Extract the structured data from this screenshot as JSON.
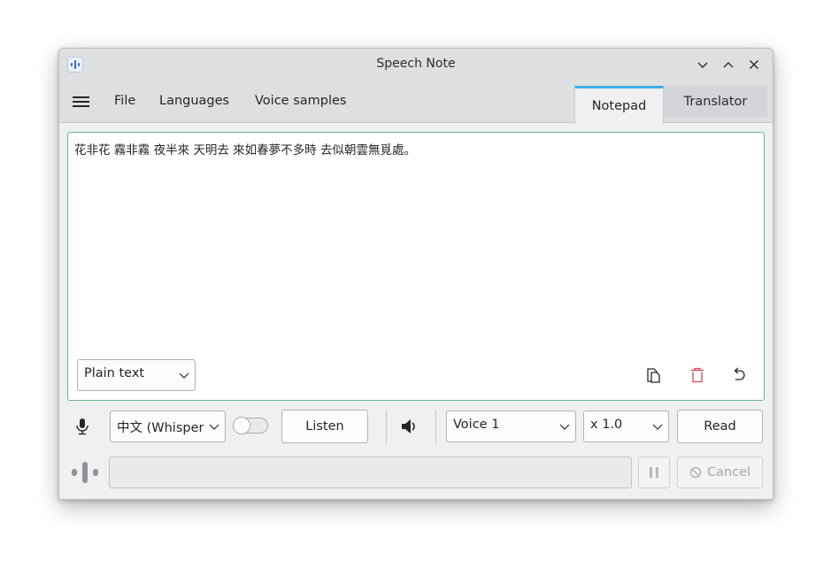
{
  "window": {
    "title": "Speech Note",
    "controls": [
      "minimize-icon",
      "maximize-icon",
      "close-icon"
    ]
  },
  "menu": {
    "items": [
      "File",
      "Languages",
      "Voice samples"
    ]
  },
  "tabs": {
    "notepad": "Notepad",
    "translator": "Translator",
    "active": "Notepad"
  },
  "editor": {
    "text": "花非花 霧非霧 夜半來 天明去 來如春夢不多時 去似朝雲無覓處。",
    "format": "Plain text"
  },
  "stt": {
    "model": "中文 (Whisper",
    "listen_label": "Listen"
  },
  "tts": {
    "voice": "Voice 1",
    "speed": "x 1.0",
    "read_label": "Read"
  },
  "status": {
    "cancel_label": "Cancel"
  },
  "colors": {
    "accent": "#3daee9",
    "editor_border": "#66b88a",
    "delete_icon": "#da4453"
  }
}
